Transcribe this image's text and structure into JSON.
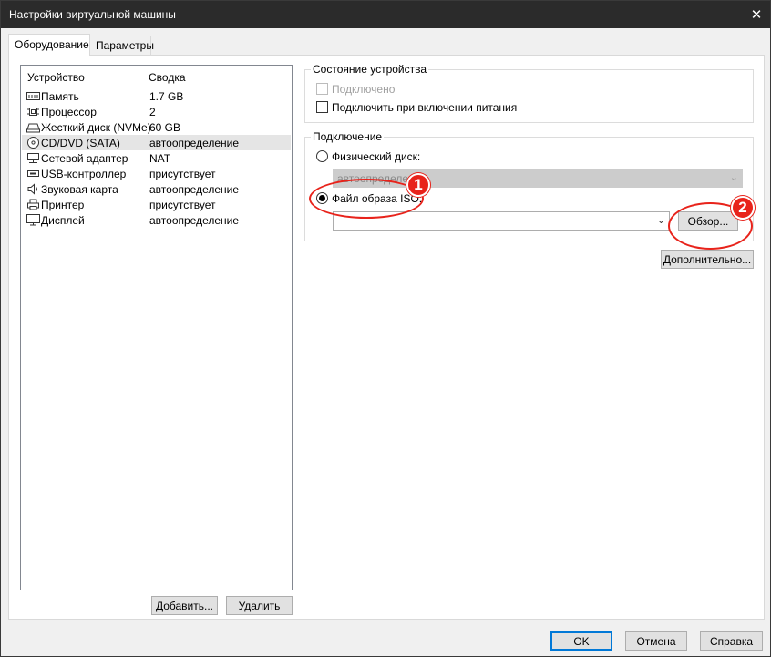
{
  "window": {
    "title": "Настройки виртуальной машины"
  },
  "tabs": [
    {
      "label": "Оборудование"
    },
    {
      "label": "Параметры"
    }
  ],
  "device_list": {
    "columns": [
      "Устройство",
      "Сводка"
    ],
    "rows": [
      {
        "name": "Память",
        "summary": "1.7 GB",
        "icon": "memory-icon"
      },
      {
        "name": "Процессор",
        "summary": "2",
        "icon": "cpu-icon"
      },
      {
        "name": "Жесткий диск (NVMe)",
        "summary": "60 GB",
        "icon": "hard-disk-icon"
      },
      {
        "name": "CD/DVD (SATA)",
        "summary": "автоопределение",
        "icon": "cd-dvd-icon"
      },
      {
        "name": "Сетевой адаптер",
        "summary": "NAT",
        "icon": "network-adapter-icon"
      },
      {
        "name": "USB-контроллер",
        "summary": "присутствует",
        "icon": "usb-icon"
      },
      {
        "name": "Звуковая карта",
        "summary": "автоопределение",
        "icon": "sound-card-icon"
      },
      {
        "name": "Принтер",
        "summary": "присутствует",
        "icon": "printer-icon"
      },
      {
        "name": "Дисплей",
        "summary": "автоопределение",
        "icon": "display-icon"
      }
    ],
    "selected_index": 3,
    "add_button": "Добавить...",
    "remove_button": "Удалить"
  },
  "device_state": {
    "legend": "Состояние устройства",
    "connected_label": "Подключено",
    "connected_checked": false,
    "connected_enabled": false,
    "connect_on_power_label": "Подключить при включении питания",
    "connect_on_power_checked": false
  },
  "connection": {
    "legend": "Подключение",
    "physical_label": "Физический диск:",
    "physical_value": "автоопределение",
    "iso_label": "Файл образа ISO:",
    "iso_value": "",
    "selected": "iso",
    "browse_button": "Обзор..."
  },
  "advanced_button": "Дополнительно...",
  "footer": {
    "ok": "OK",
    "cancel": "Отмена",
    "help": "Справка"
  },
  "annotations": {
    "marker_1": "1",
    "marker_2": "2",
    "color": "#e8231b"
  },
  "colors": {
    "titlebar": "#2b2b2b",
    "selection": "#e5e5e5",
    "accent": "#0078d7"
  }
}
